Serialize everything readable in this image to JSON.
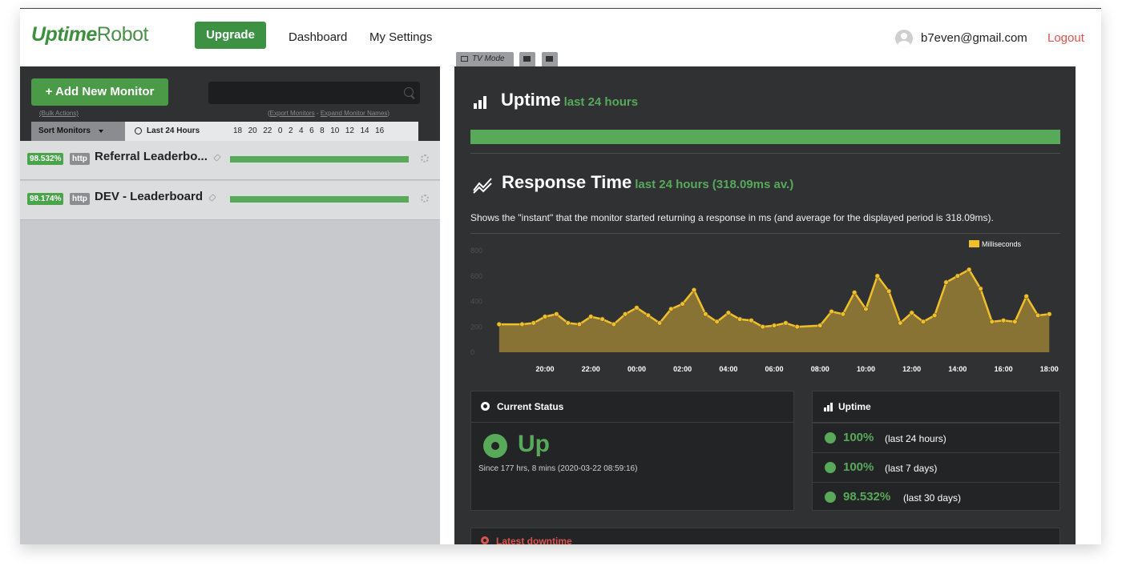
{
  "header": {
    "logo_main": "Uptime",
    "logo_sub": "Robot",
    "upgrade_label": "Upgrade",
    "nav": [
      "Dashboard",
      "My Settings"
    ],
    "user_email": "b7even@gmail.com",
    "logout_label": "Logout"
  },
  "sidebar": {
    "add_monitor_label": "+ Add New Monitor",
    "search_placeholder": "",
    "bulk_actions_label": "(Bulk Actions)",
    "export_label": "Export Monitors",
    "expand_label": "Expand Monitor Names",
    "sort_label": "Sort Monitors",
    "period_label": "Last 24 Hours",
    "hours": [
      "18",
      "20",
      "22",
      "0",
      "2",
      "4",
      "6",
      "8",
      "10",
      "12",
      "14",
      "16"
    ],
    "monitors": [
      {
        "uptime": "98.532%",
        "type": "http",
        "name": "Referral Leaderbo...",
        "bar_fill": 1.0
      },
      {
        "uptime": "98.174%",
        "type": "http",
        "name": "DEV - Leaderboard",
        "bar_fill": 1.0
      }
    ]
  },
  "tabs": {
    "tv_mode": "TV Mode"
  },
  "uptime_section": {
    "title": "Uptime",
    "period": "last 24 hours",
    "bar_fill": 1.0
  },
  "response_section": {
    "title": "Response Time",
    "period": "last 24 hours",
    "average": "(318.09ms av.)",
    "description": "Shows the \"instant\" that the monitor started returning a response in ms (and average for the displayed period is 318.09ms)."
  },
  "chart_data": {
    "type": "area",
    "ylim": [
      0,
      800
    ],
    "y_ticks": [
      0,
      200,
      400,
      600,
      800
    ],
    "x_ticks": [
      "20:00",
      "22:00",
      "00:00",
      "02:00",
      "04:00",
      "06:00",
      "08:00",
      "10:00",
      "12:00",
      "14:00",
      "16:00",
      "18:00"
    ],
    "x_range_hours": [
      17.9,
      42.2
    ],
    "legend": "Milliseconds",
    "legend_position": "top-right",
    "color": "#f0c02c",
    "series": [
      {
        "x": [
          18.0,
          19.0,
          19.5,
          20.0,
          20.5,
          21.0,
          21.5,
          22.0,
          22.5,
          23.0,
          23.5,
          24.0,
          24.5,
          25.0,
          25.5,
          26.0,
          26.5,
          27.0,
          27.5,
          28.0,
          28.5,
          29.0,
          29.5,
          30.0,
          30.5,
          31.0,
          32.0,
          32.5,
          33.0,
          33.5,
          34.0,
          34.5,
          35.0,
          35.5,
          36.0,
          36.5,
          37.0,
          37.5,
          38.0,
          38.5,
          39.0,
          39.5,
          40.0,
          40.5,
          41.0,
          41.5,
          42.0
        ],
        "y": [
          220,
          220,
          230,
          280,
          300,
          230,
          220,
          280,
          260,
          220,
          300,
          350,
          290,
          230,
          340,
          380,
          490,
          300,
          240,
          310,
          260,
          250,
          200,
          210,
          230,
          200,
          210,
          320,
          300,
          470,
          340,
          600,
          480,
          230,
          310,
          240,
          290,
          550,
          600,
          650,
          500,
          240,
          250,
          240,
          440,
          290,
          300
        ]
      }
    ]
  },
  "current_status": {
    "title": "Current Status",
    "state": "Up",
    "since": "Since 177 hrs, 8 mins (2020-03-22 08:59:16)"
  },
  "uptime_box": {
    "title": "Uptime",
    "rows": [
      {
        "value": "100%",
        "period": "(last 24 hours)"
      },
      {
        "value": "100%",
        "period": "(last 7 days)"
      },
      {
        "value": "98.532%",
        "period": "(last 30 days)"
      }
    ]
  },
  "downtime": {
    "title": "Latest downtime"
  }
}
